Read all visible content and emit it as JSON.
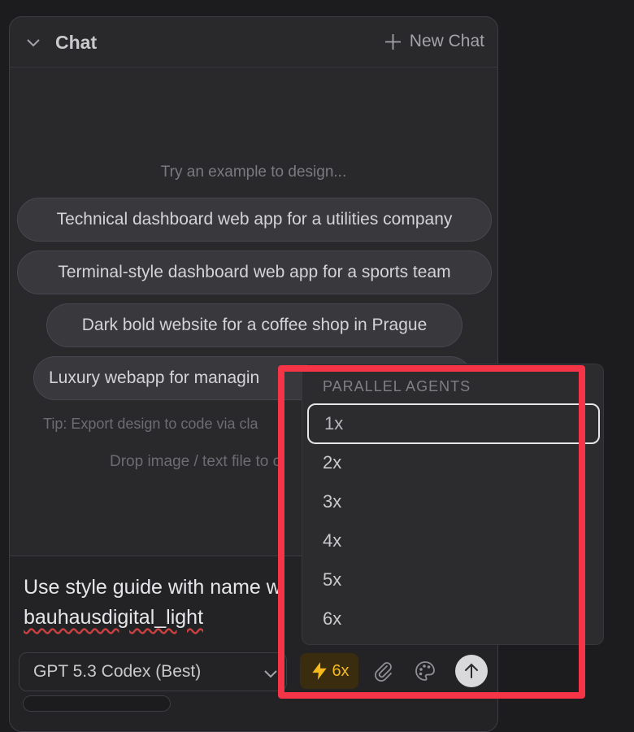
{
  "header": {
    "title": "Chat",
    "new_chat": "New Chat"
  },
  "empty_state": {
    "prompt": "Try an example to design...",
    "examples": [
      "Technical dashboard web app for a utilities company",
      "Terminal-style dashboard web app for a sports team",
      "Dark bold website for a coffee shop in Prague",
      "Luxury webapp for managin"
    ],
    "tip": "Tip: Export design to code via cla",
    "drop_hint": "Drop image / text file to c"
  },
  "composer": {
    "message_line1": "Use style guide with name w",
    "message_line2": "bauhausdigital_light",
    "model": "GPT 5.3 Codex (Best)",
    "agents_count": "6x"
  },
  "dropdown": {
    "heading": "PARALLEL AGENTS",
    "options": [
      "1x",
      "2x",
      "3x",
      "4x",
      "5x",
      "6x"
    ],
    "selected": "1x"
  },
  "colors": {
    "accent": "#f5b920",
    "highlight": "#f53447"
  }
}
